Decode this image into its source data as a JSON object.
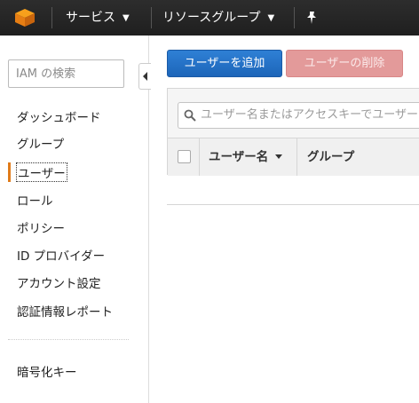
{
  "topbar": {
    "logo_icon": "aws-cube-icon",
    "services_label": "サービス",
    "resource_groups_label": "リソースグループ",
    "pin_icon": "pin-icon",
    "caret_icon": "chevron-down-icon"
  },
  "sidebar": {
    "search_placeholder": "IAM の検索",
    "items": [
      {
        "label": "ダッシュボード"
      },
      {
        "label": "グループ"
      },
      {
        "label": "ユーザー",
        "active": true
      },
      {
        "label": "ロール"
      },
      {
        "label": "ポリシー"
      },
      {
        "label": "ID プロバイダー"
      },
      {
        "label": "アカウント設定"
      },
      {
        "label": "認証情報レポート"
      }
    ],
    "secondary_items": [
      {
        "label": "暗号化キー"
      }
    ],
    "active_color": "#e07b1a"
  },
  "main": {
    "add_user_label": "ユーザーを追加",
    "delete_user_label": "ユーザーの削除",
    "search_placeholder": "ユーザー名またはアクセスキーでユーザーを検索",
    "table": {
      "columns": [
        "ユーザー名",
        "グループ"
      ]
    },
    "colors": {
      "primary": "#1c65b9",
      "danger_disabled": "#e39a9a"
    }
  }
}
